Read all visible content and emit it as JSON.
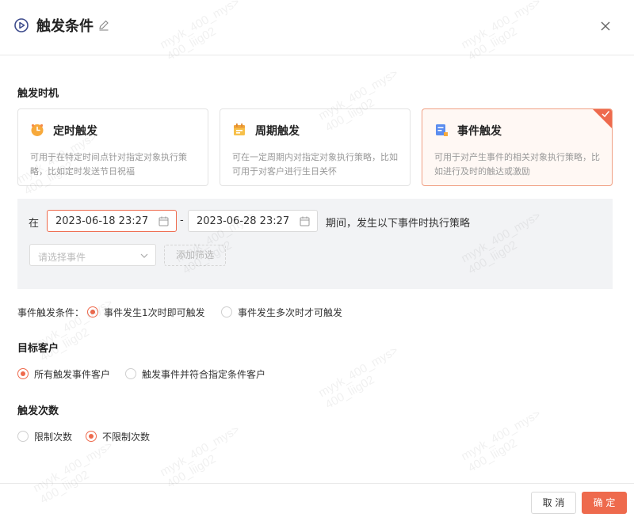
{
  "dialog": {
    "title": "触发条件",
    "title_icon": "play-circle-icon",
    "edit_icon": "pencil-icon",
    "close_icon": "close-icon"
  },
  "trigger_time": {
    "label": "触发时机",
    "cards": [
      {
        "title": "定时触发",
        "desc": "可用于在特定时间点针对指定对象执行策略，比如定时发送节日祝福",
        "icon": "clock-icon",
        "selected": false
      },
      {
        "title": "周期触发",
        "desc": "可在一定周期内对指定对象执行策略，比如可用于对客户进行生日关怀",
        "icon": "calendar-icon",
        "selected": false
      },
      {
        "title": "事件触发",
        "desc": "可用于对产生事件的相关对象执行策略，比如进行及时的触达或激励",
        "icon": "document-icon",
        "selected": true
      }
    ]
  },
  "event_panel": {
    "prefix": "在",
    "start_date": "2023-06-18 23:27",
    "separator": "-",
    "end_date": "2023-06-28 23:27",
    "suffix": "期间，发生以下事件时执行策略",
    "event_select_placeholder": "请选择事件",
    "add_filter_label": "添加筛选"
  },
  "event_condition": {
    "label": "事件触发条件：",
    "options": [
      {
        "label": "事件发生1次时即可触发",
        "checked": true
      },
      {
        "label": "事件发生多次时才可触发",
        "checked": false
      }
    ]
  },
  "target": {
    "label": "目标客户",
    "options": [
      {
        "label": "所有触发事件客户",
        "checked": true
      },
      {
        "label": "触发事件并符合指定条件客户",
        "checked": false
      }
    ]
  },
  "times": {
    "label": "触发次数",
    "options": [
      {
        "label": "限制次数",
        "checked": false
      },
      {
        "label": "不限制次数",
        "checked": true
      }
    ]
  },
  "footer": {
    "cancel_label": "取 消",
    "ok_label": "确 定"
  },
  "watermark": "myyk_400_mys>\n400_liig02",
  "colors": {
    "accent": "#ee6a4d",
    "panel_bg": "#f2f3f5",
    "selected_card_bg": "#fff8f4"
  }
}
